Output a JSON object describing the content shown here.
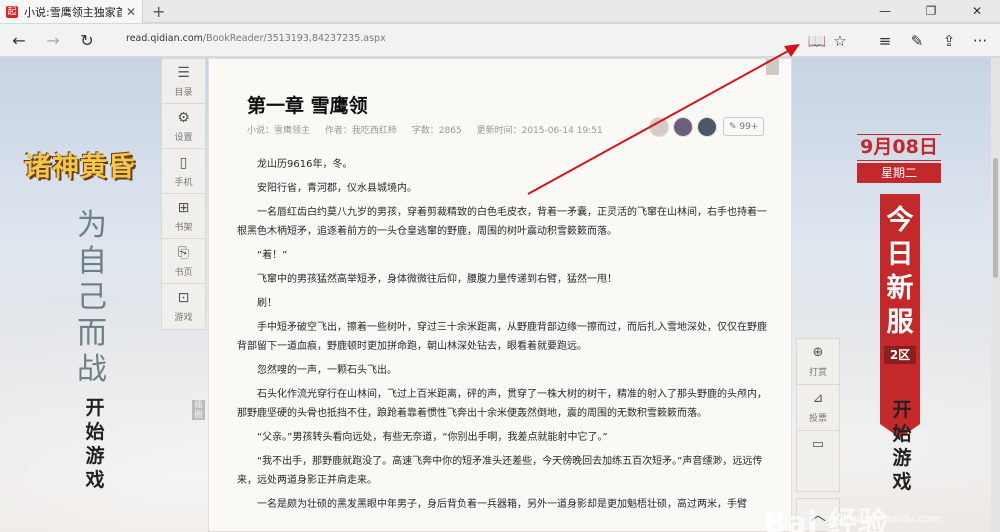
{
  "browser": {
    "tab_title": "小说:雪鹰领主独家首发",
    "favicon": "起",
    "close_glyph": "✕",
    "new_tab_glyph": "+",
    "url_host": "read.qidian.com",
    "url_path": "/BookReader/3513193,84237235.aspx",
    "back_glyph": "←",
    "forward_glyph": "→",
    "refresh_glyph": "↻",
    "reading_view_glyph": "📖",
    "favorite_glyph": "☆",
    "hub_glyph": "≡",
    "note_glyph": "✎",
    "share_glyph": "⇪",
    "more_glyph": "···",
    "minimize_glyph": "—",
    "restore_glyph": "❐",
    "win_close_glyph": "✕"
  },
  "left_ad": {
    "logo": "诸神黄昏",
    "slogan": "为自己而战",
    "brush_text": "开始游戏"
  },
  "left_toolbar": [
    {
      "icon": "☰",
      "label": "目录"
    },
    {
      "icon": "⚙",
      "label": "设置"
    },
    {
      "icon": "▯",
      "label": "手机"
    },
    {
      "icon": "⊞",
      "label": "书架"
    },
    {
      "icon": "⎘",
      "label": "书页"
    },
    {
      "icon": "⊡",
      "label": "游戏"
    }
  ],
  "side_tag": "插图",
  "chapter": {
    "title": "第一章 雪鹰领",
    "book": "小说：雪鹰领主",
    "author": "作者：我吃西红柿",
    "words": "字数：2865",
    "updated": "更新时间：2015-06-14 19:51",
    "likes": "✎ 99+",
    "paragraphs": [
      "龙山历9616年，冬。",
      "安阳行省，青河郡，仪水县城境内。",
      "一名唇红齿白约莫八九岁的男孩，穿着剪裁精致的白色毛皮衣，背着一矛囊，正灵活的飞窜在山林间，右手也持着一根黑色木柄短矛，追逐着前方的一头仓皇逃窜的野鹿，周围的树叶震动积雪簌簌而落。",
      "“着！”",
      "飞窜中的男孩猛然高举短矛，身体微微往后仰，腰腹力量传递到右臂，猛然一甩！",
      "刷！",
      "手中短矛破空飞出，擦着一些树叶，穿过三十余米距离，从野鹿背部边缘一擦而过，而后扎入雪地深处，仅仅在野鹿背部留下一道血痕，野鹿顿时更加拼命跑，朝山林深处钻去，眼看着就要跑远。",
      "忽然嗖的一声，一颗石头飞出。",
      "石头化作流光穿行在山林间，飞过上百米距离，砰的声，贯穿了一株大树的树干，精准的射入了那头野鹿的头颅内，那野鹿坚硬的头骨也抵挡不住，踉跄着靠着惯性飞奔出十余米便轰然倒地，震的周围的无数积雪簌簌而落。",
      "“父亲。”男孩转头看向远处，有些无奈道，“你别出手啊，我差点就能射中它了。”",
      "“我不出手，那野鹿就跑没了。高速飞奔中你的短矛准头还差些，今天傍晚回去加练五百次短矛。”声音缥渺，远远传来，远处两道身影正并肩走来。",
      "一名是颇为壮硕的黑发黑眼中年男子，身后背负着一兵器箱，另外一道身影却是更加魁梧壮硕，高过两米，手臂"
    ]
  },
  "right_toolbar": [
    {
      "icon": "⊕",
      "label": "打赏"
    },
    {
      "icon": "⊿",
      "label": "投票"
    },
    {
      "icon": "▭",
      "label": ""
    }
  ],
  "up_glyph": "︿",
  "right_ad": {
    "date": "9月08日",
    "weekday": "星期二",
    "slogan": "今日新服",
    "zone": "2区",
    "brush_text": "开始游戏"
  },
  "watermark": "Bai 经验",
  "watermark_sub": "jingyan.baidu.com",
  "colors": {
    "accent_red": "#c3282b",
    "arrow_red": "#d0151c"
  }
}
